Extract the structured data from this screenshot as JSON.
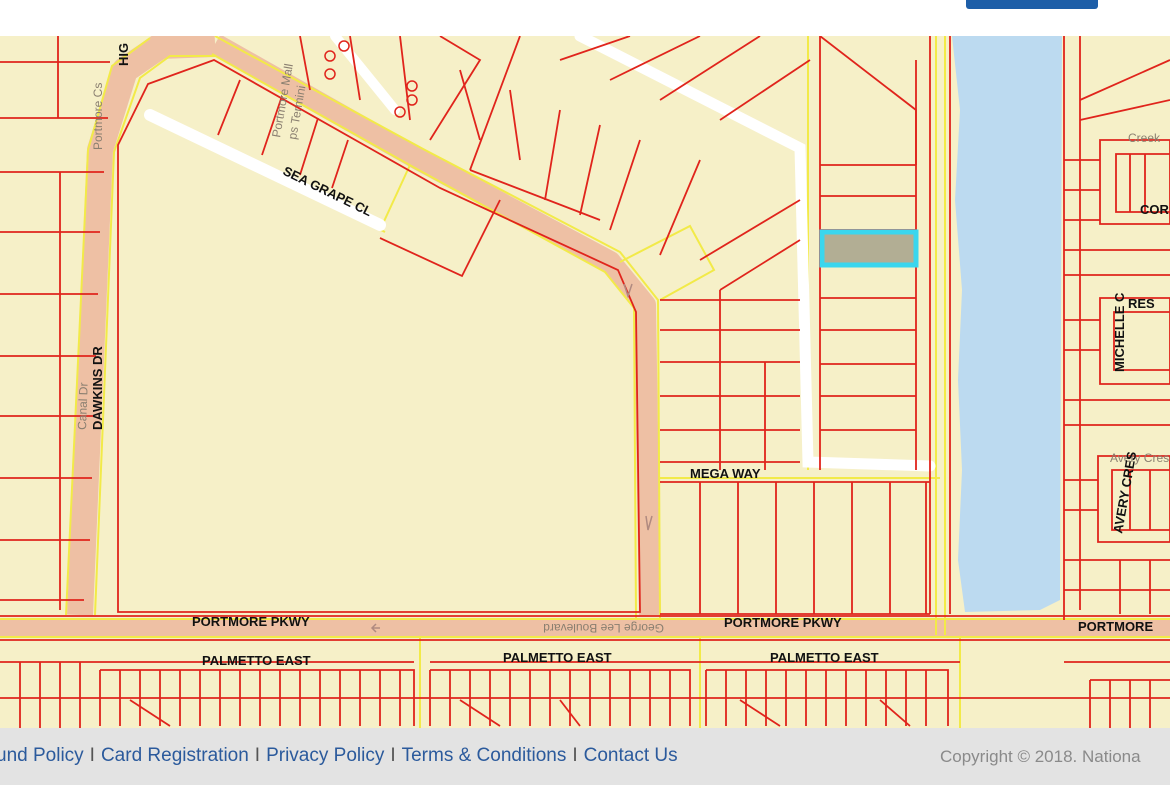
{
  "map": {
    "colors": {
      "land": "#f6f0c8",
      "parcel_line": "#e0241c",
      "road_fill": "#eec0a4",
      "road_edge": "#f2ea48",
      "water": "#bcdaf0",
      "highlight_border": "#3ad6ee",
      "highlight_fill": "#b2ae94"
    },
    "labels": {
      "higdon": "HIG",
      "portmore_cs": "Portmore Cs",
      "canal_dr": "Canal Dr",
      "dawkins_dr": "DAWKINS DR",
      "portmore_mall": "Portmore Mall",
      "ps_faint": "ps Termini",
      "sea_grape_cl": "SEA GRAPE CL",
      "mega_way": "MEGA WAY",
      "portmore_pkwy_west": "PORTMORE PKWY",
      "george_lee_blvd": "George Lee Boulevard",
      "portmore_pkwy_center": "PORTMORE PKWY",
      "portmore_pkwy_east": "PORTMORE",
      "palmetto_east_1": "PALMETTO EAST",
      "palmetto_east_2": "PALMETTO EAST",
      "palmetto_east_3": "PALMETTO EAST",
      "creek_faint": "Creek",
      "corr": "COR",
      "res": "RES",
      "michelle_c": "MICHELLE C",
      "avery_cres": "AVERY CRES",
      "avery_faint": "Avery Cresce"
    }
  },
  "header": {
    "button_color": "#1d5ea8"
  },
  "footer": {
    "links": [
      "und Policy",
      "Card Registration",
      "Privacy Policy",
      "Terms & Conditions",
      "Contact Us"
    ],
    "separator": "I",
    "copyright": "Copyright © 2018. Nationa"
  }
}
